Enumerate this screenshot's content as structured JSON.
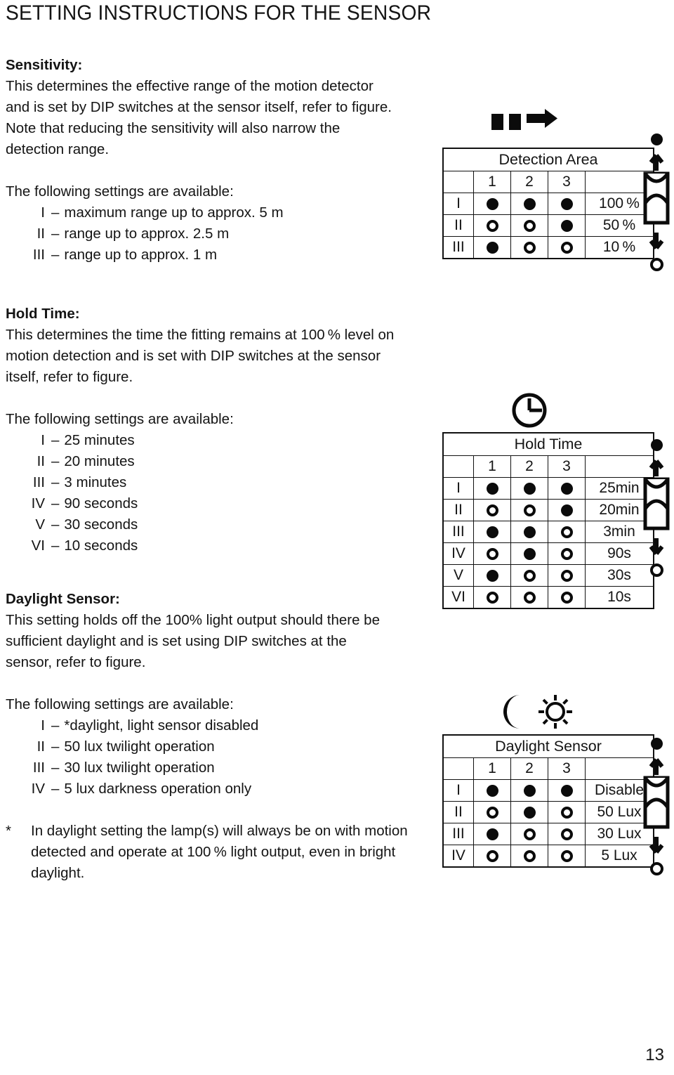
{
  "page": {
    "title": "SETTING INSTRUCTIONS FOR THE SENSOR",
    "number": "13"
  },
  "sensitivity": {
    "heading": "Sensitivity:",
    "body": "This determines the effective range of the motion detector and is set by DIP switches at the sensor itself, refer to figure. Note that reducing the sensitivity will also narrow the detection range.",
    "settings_intro": "The following settings are available:",
    "settings": [
      {
        "numeral": "I",
        "dash": "–",
        "text": "maximum range up to approx. 5 m"
      },
      {
        "numeral": "II",
        "dash": "–",
        "text": "range up to approx. 2.5 m"
      },
      {
        "numeral": "III",
        "dash": "–",
        "text": "range up to approx. 1 m"
      }
    ]
  },
  "hold_time": {
    "heading": "Hold Time:",
    "body": "This determines the time the fitting remains at 100 % level on motion detection and is set with DIP switches at the sensor itself, refer to figure.",
    "settings_intro": "The following settings are available:",
    "settings": [
      {
        "numeral": "I",
        "dash": "–",
        "text": "25 minutes"
      },
      {
        "numeral": "II",
        "dash": "–",
        "text": "20 minutes"
      },
      {
        "numeral": "III",
        "dash": "–",
        "text": "3 minutes"
      },
      {
        "numeral": "IV",
        "dash": "–",
        "text": "90 seconds"
      },
      {
        "numeral": "V",
        "dash": "–",
        "text": "30 seconds"
      },
      {
        "numeral": "VI",
        "dash": "–",
        "text": "10 seconds"
      }
    ]
  },
  "daylight_sensor": {
    "heading": "Daylight Sensor:",
    "body": "This setting holds off the 100% light output should there be sufficient daylight and is set using DIP switches at the sensor, refer to figure.",
    "settings_intro": "The following settings are available:",
    "settings": [
      {
        "numeral": "I",
        "dash": "–",
        "text": "*daylight, light sensor disabled"
      },
      {
        "numeral": "II",
        "dash": "–",
        "text": "50 lux twilight operation"
      },
      {
        "numeral": "III",
        "dash": "–",
        "text": "30 lux twilight operation"
      },
      {
        "numeral": "IV",
        "dash": "–",
        "text": "5 lux darkness operation only"
      }
    ],
    "footnote_marker": "*",
    "footnote": "In daylight setting the lamp(s) will always be on with motion detected and operate at 100 % light output, even in bright daylight."
  },
  "figures": {
    "detection_area": {
      "icon": "motion-arrow-icon",
      "title": "Detection Area",
      "switch_headers": [
        "1",
        "2",
        "3"
      ],
      "rows": [
        {
          "numeral": "I",
          "switches": [
            "on",
            "on",
            "on"
          ],
          "value": "100 %"
        },
        {
          "numeral": "II",
          "switches": [
            "off",
            "off",
            "on"
          ],
          "value": "50 %"
        },
        {
          "numeral": "III",
          "switches": [
            "on",
            "off",
            "off"
          ],
          "value": "10 %"
        }
      ]
    },
    "hold_time": {
      "icon": "clock-icon",
      "title": "Hold Time",
      "switch_headers": [
        "1",
        "2",
        "3"
      ],
      "rows": [
        {
          "numeral": "I",
          "switches": [
            "on",
            "on",
            "on"
          ],
          "value": "25min"
        },
        {
          "numeral": "II",
          "switches": [
            "off",
            "off",
            "on"
          ],
          "value": "20min"
        },
        {
          "numeral": "III",
          "switches": [
            "on",
            "on",
            "off"
          ],
          "value": "3min"
        },
        {
          "numeral": "IV",
          "switches": [
            "off",
            "on",
            "off"
          ],
          "value": "90s"
        },
        {
          "numeral": "V",
          "switches": [
            "on",
            "off",
            "off"
          ],
          "value": "30s"
        },
        {
          "numeral": "VI",
          "switches": [
            "off",
            "off",
            "off"
          ],
          "value": "10s"
        }
      ]
    },
    "daylight_sensor": {
      "icon": "moon-sun-icon",
      "title": "Daylight Sensor",
      "switch_headers": [
        "1",
        "2",
        "3"
      ],
      "rows": [
        {
          "numeral": "I",
          "switches": [
            "on",
            "on",
            "on"
          ],
          "value": "Disable"
        },
        {
          "numeral": "II",
          "switches": [
            "off",
            "on",
            "off"
          ],
          "value": "50 Lux"
        },
        {
          "numeral": "III",
          "switches": [
            "on",
            "off",
            "off"
          ],
          "value": "30 Lux"
        },
        {
          "numeral": "IV",
          "switches": [
            "off",
            "off",
            "off"
          ],
          "value": "5 Lux"
        }
      ]
    },
    "dip_device_legend": {
      "icon": "dip-switch-device-icon",
      "up_state": "on",
      "down_state": "off"
    }
  },
  "colors": {
    "ink": "#141414",
    "glyph": "#0b0b0b",
    "paper": "#ffffff"
  }
}
